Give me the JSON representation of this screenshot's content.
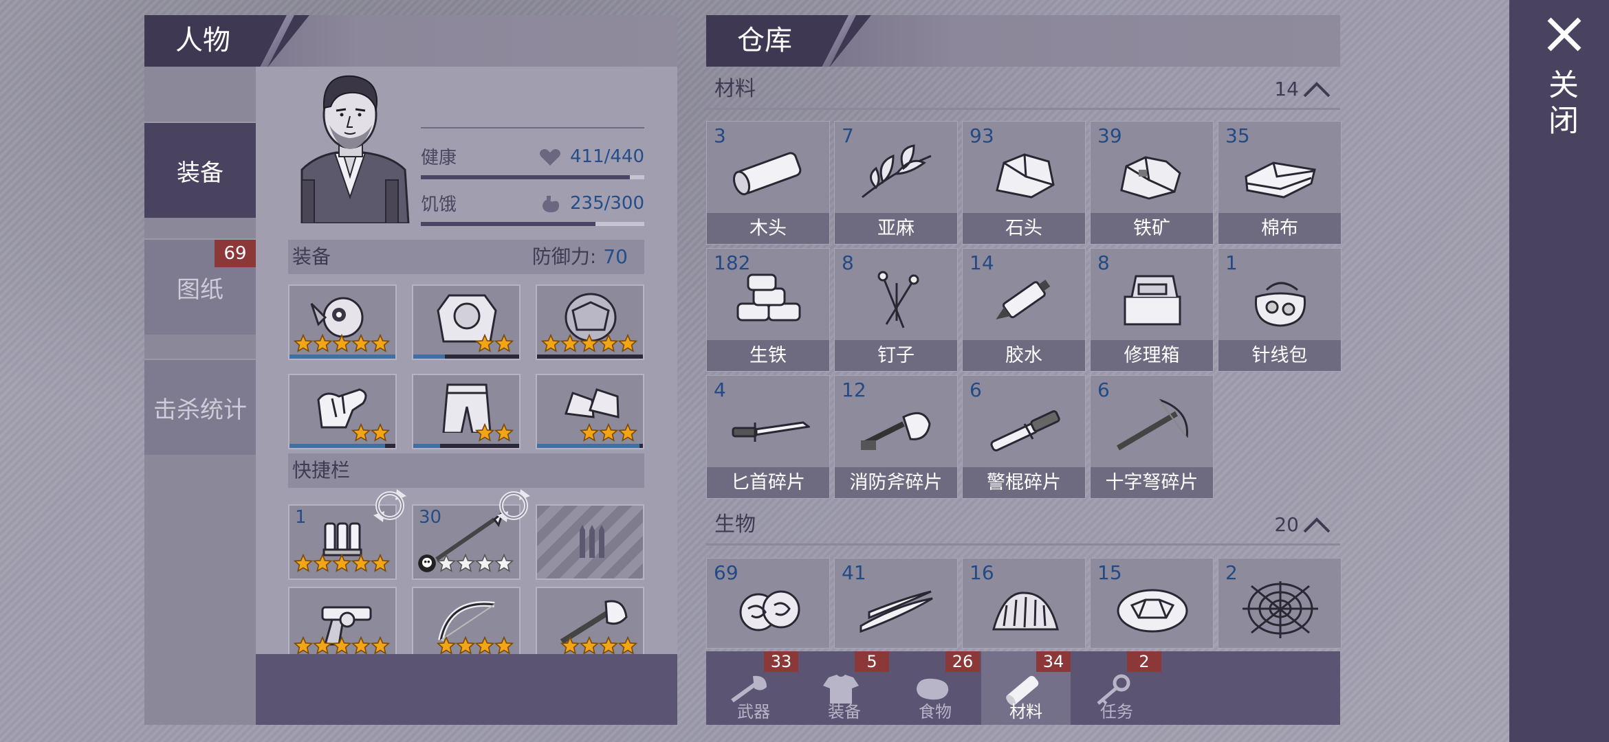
{
  "character": {
    "title": "人物",
    "side_tabs": [
      {
        "label": "装备",
        "active": true
      },
      {
        "label": "图纸",
        "badge": "69"
      },
      {
        "label": "击杀统计"
      }
    ],
    "stats": {
      "health_label": "健康",
      "health_value": "411/440",
      "health_ratio": 0.934,
      "hunger_label": "饥饿",
      "hunger_value": "235/300",
      "hunger_ratio": 0.783
    },
    "equipment_label": "装备",
    "defense_label": "防御力:",
    "defense_value": "70",
    "equipment_slots": [
      {
        "item": "gas-mask-helmet",
        "stars": 5,
        "durability": 1.0
      },
      {
        "item": "armored-vest",
        "stars": 2,
        "durability": 0.3
      },
      {
        "item": "turtle-shell-armor",
        "stars": 5,
        "durability": 0.0
      },
      {
        "item": "gloves",
        "stars": 2,
        "durability": 0.9
      },
      {
        "item": "armored-pants",
        "stars": 2,
        "durability": 0.25
      },
      {
        "item": "sneakers",
        "stars": 3,
        "durability": 0.97
      }
    ],
    "quickbar_label": "快捷栏",
    "quickbar_slots": [
      {
        "item": "shotgun-shells",
        "qty": "1",
        "stars": 5,
        "swap": true
      },
      {
        "item": "spear",
        "qty": "30",
        "stars": 4,
        "swap": true,
        "skull": true
      },
      {
        "item": "locked",
        "locked": true
      },
      {
        "item": "revolver",
        "stars": 5,
        "durability": 1.0
      },
      {
        "item": "bow",
        "stars": 4,
        "durability": 0.1,
        "low": true
      },
      {
        "item": "fire-axe",
        "stars": 4,
        "durability": 0.25
      }
    ]
  },
  "warehouse": {
    "title": "仓库",
    "categories": [
      {
        "name": "材料",
        "count": "14"
      },
      {
        "name": "生物",
        "count": "20"
      }
    ],
    "materials": [
      {
        "qty": "3",
        "name": "木头",
        "icon": "log-icon"
      },
      {
        "qty": "7",
        "name": "亚麻",
        "icon": "flax-icon"
      },
      {
        "qty": "93",
        "name": "石头",
        "icon": "stone-icon"
      },
      {
        "qty": "39",
        "name": "铁矿",
        "icon": "iron-ore-icon"
      },
      {
        "qty": "35",
        "name": "棉布",
        "icon": "cloth-icon"
      },
      {
        "qty": "182",
        "name": "生铁",
        "icon": "iron-ingot-icon"
      },
      {
        "qty": "8",
        "name": "钉子",
        "icon": "nails-icon"
      },
      {
        "qty": "14",
        "name": "胶水",
        "icon": "glue-icon"
      },
      {
        "qty": "8",
        "name": "修理箱",
        "icon": "repair-kit-icon"
      },
      {
        "qty": "1",
        "name": "针线包",
        "icon": "sewing-kit-icon"
      },
      {
        "qty": "4",
        "name": "匕首碎片",
        "icon": "dagger-fragment-icon"
      },
      {
        "qty": "12",
        "name": "消防斧碎片",
        "icon": "axe-fragment-icon"
      },
      {
        "qty": "6",
        "name": "警棍碎片",
        "icon": "baton-fragment-icon"
      },
      {
        "qty": "6",
        "name": "十字弩碎片",
        "icon": "crossbow-fragment-icon"
      }
    ],
    "creatures": [
      {
        "qty": "69",
        "icon": "intestine-icon"
      },
      {
        "qty": "41",
        "icon": "tendon-icon"
      },
      {
        "qty": "16",
        "icon": "fur-icon"
      },
      {
        "qty": "15",
        "icon": "turtle-shell-icon"
      },
      {
        "qty": "2",
        "icon": "spider-web-icon"
      }
    ],
    "tabs": [
      {
        "label": "武器",
        "badge": "33",
        "icon": "axe-tab-icon"
      },
      {
        "label": "装备",
        "badge": "5",
        "icon": "shirt-tab-icon"
      },
      {
        "label": "食物",
        "badge": "26",
        "icon": "meat-tab-icon"
      },
      {
        "label": "材料",
        "badge": "34",
        "icon": "log-tab-icon",
        "active": true
      },
      {
        "label": "任务",
        "badge": "2",
        "icon": "key-tab-icon"
      }
    ]
  },
  "close_label": "关闭",
  "colors": {
    "accent_dark": "#4a4360",
    "badge_red": "#8c3838",
    "value_blue": "#244e8a",
    "star_gold": "#f2a516"
  }
}
